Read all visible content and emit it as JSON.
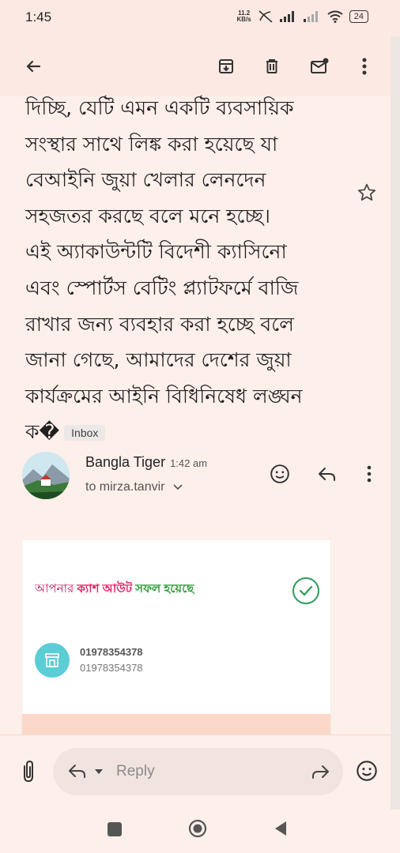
{
  "status": {
    "time": "1:45",
    "net_speed_value": "11.2",
    "net_speed_unit": "KB/s",
    "battery": "24"
  },
  "toolbar": {
    "icons": [
      "back-arrow-icon",
      "archive-icon",
      "delete-icon",
      "mark-unread-icon",
      "more-vert-icon"
    ]
  },
  "email": {
    "body_lines": [
      "দিচ্ছি, যেটি এমন একটি ব্যবসায়িক",
      "সংস্থার সাথে লিঙ্ক করা হয়েছে যা",
      "বেআইনি জুয়া খেলার লেনদেন",
      "সহজতর করছে বলে মনে হচ্ছে।",
      "এই অ্যাকাউন্টটি বিদেশী ক্যাসিনো",
      "এবং স্পোর্টস বেটিং প্ল্যাটফর্মে বাজি",
      "রাখার জন্য ব্যবহার করা হচ্ছে বলে",
      "জানা গেছে, আমাদের দেশের জুয়া",
      "কার্যক্রমের আইনি বিধিনিষেধ লঙ্ঘন",
      "ক�"
    ],
    "inbox_label": "Inbox"
  },
  "sender": {
    "name": "Bangla Tiger",
    "time": "1:42 am",
    "to": "to mirza.tanvir"
  },
  "card": {
    "title_part1": "আপনার ",
    "title_part2": "ক্যাশ আউট",
    "title_part3": " সফল হয়েছে",
    "number_primary": "01978354378",
    "number_secondary": "01978354378"
  },
  "reply_bar": {
    "placeholder": "Reply"
  },
  "colors": {
    "accent_pink": "#e91e63",
    "success_green": "#2e9b3a",
    "background": "#fdefea"
  }
}
